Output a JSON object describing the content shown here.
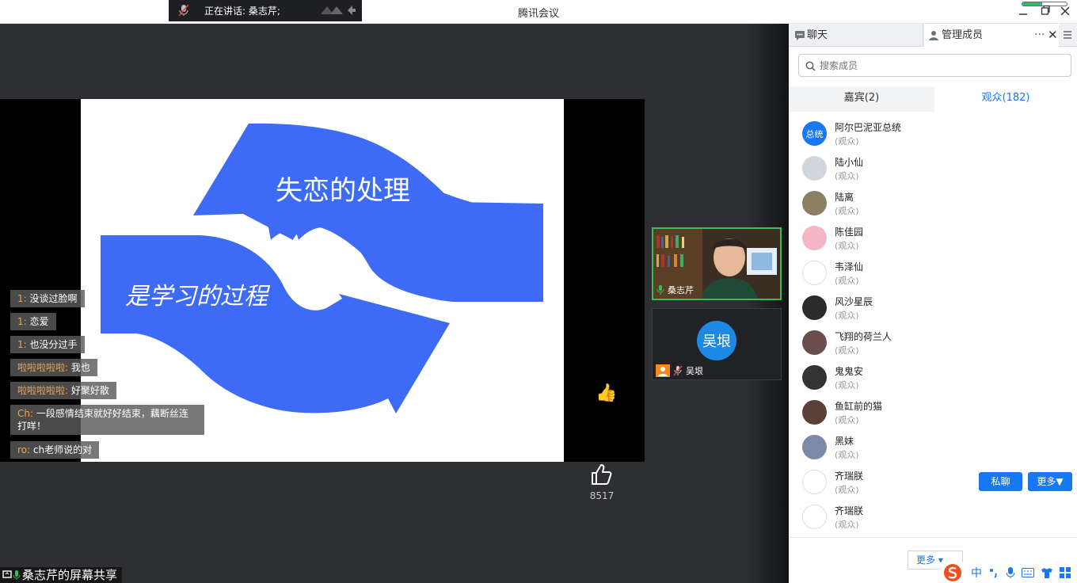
{
  "app": {
    "title": "腾讯会议"
  },
  "speaking": {
    "label": "正在讲话: 桑志芹;"
  },
  "slide": {
    "title1": "失恋的处理",
    "title2": "是学习的过程",
    "shape_color": "#3d6bf5"
  },
  "comments": [
    {
      "who": "1:",
      "text": "没谈过脸啊"
    },
    {
      "who": "1:",
      "text": "恋爱"
    },
    {
      "who": "1:",
      "text": "也没分过手"
    },
    {
      "who": "啦啦啦啦啦:",
      "text": "我也"
    },
    {
      "who": "啦啦啦啦啦:",
      "text": "好聚好散"
    },
    {
      "who": "Ch:",
      "text": "一段感情结束就好好结束，藕断丝连打咩！"
    },
    {
      "who": "ro:",
      "text": "ch老师说的对"
    }
  ],
  "reactions": {
    "thumbs": "👍",
    "grin": "😁"
  },
  "likes": {
    "count": "8517"
  },
  "share_label": "桑志芹的屏幕共享",
  "video_tiles": [
    {
      "name": "桑志芹"
    },
    {
      "name": "吴垠",
      "avatar_text": "吴垠"
    }
  ],
  "panel": {
    "tab_chat": "聊天",
    "tab_members": "管理成员",
    "search_placeholder": "搜索成员",
    "subtab_guests": "嘉宾(2)",
    "subtab_audience": "观众(182)",
    "members": [
      {
        "name": "阿尔巴泥亚总统",
        "role": "(观众)",
        "avatar_text": "总统",
        "color": "#1877f2"
      },
      {
        "name": "陆小仙",
        "role": "(观众)",
        "avatar_text": "",
        "color": "#cfd6de"
      },
      {
        "name": "陆离",
        "role": "(观众)",
        "avatar_text": "",
        "color": "#8c7f62"
      },
      {
        "name": "陈佳园",
        "role": "(观众)",
        "avatar_text": "",
        "color": "#f4b6c2"
      },
      {
        "name": "韦泽仙",
        "role": "(观众)",
        "avatar_text": "",
        "color": "#ffffff"
      },
      {
        "name": "风沙星辰",
        "role": "(观众)",
        "avatar_text": "",
        "color": "#2b2b2b"
      },
      {
        "name": "飞翔的荷兰人",
        "role": "(观众)",
        "avatar_text": "",
        "color": "#6b4d4d"
      },
      {
        "name": "鬼鬼安",
        "role": "(观众)",
        "avatar_text": "",
        "color": "#333333"
      },
      {
        "name": "鱼缸前的猫",
        "role": "(观众)",
        "avatar_text": "",
        "color": "#5a4036"
      },
      {
        "name": "黑妹",
        "role": "(观众)",
        "avatar_text": "",
        "color": "#7a8aa8"
      },
      {
        "name": "齐瑞朕",
        "role": "(观众)",
        "avatar_text": "",
        "color": "#ffffff"
      },
      {
        "name": "齐瑞朕",
        "role": "(观众)",
        "avatar_text": "",
        "color": "#ffffff"
      }
    ],
    "btn_private_chat": "私聊",
    "btn_more": "更多▼",
    "more_link": "更多 ▾"
  },
  "ime": {
    "lang": "中"
  }
}
